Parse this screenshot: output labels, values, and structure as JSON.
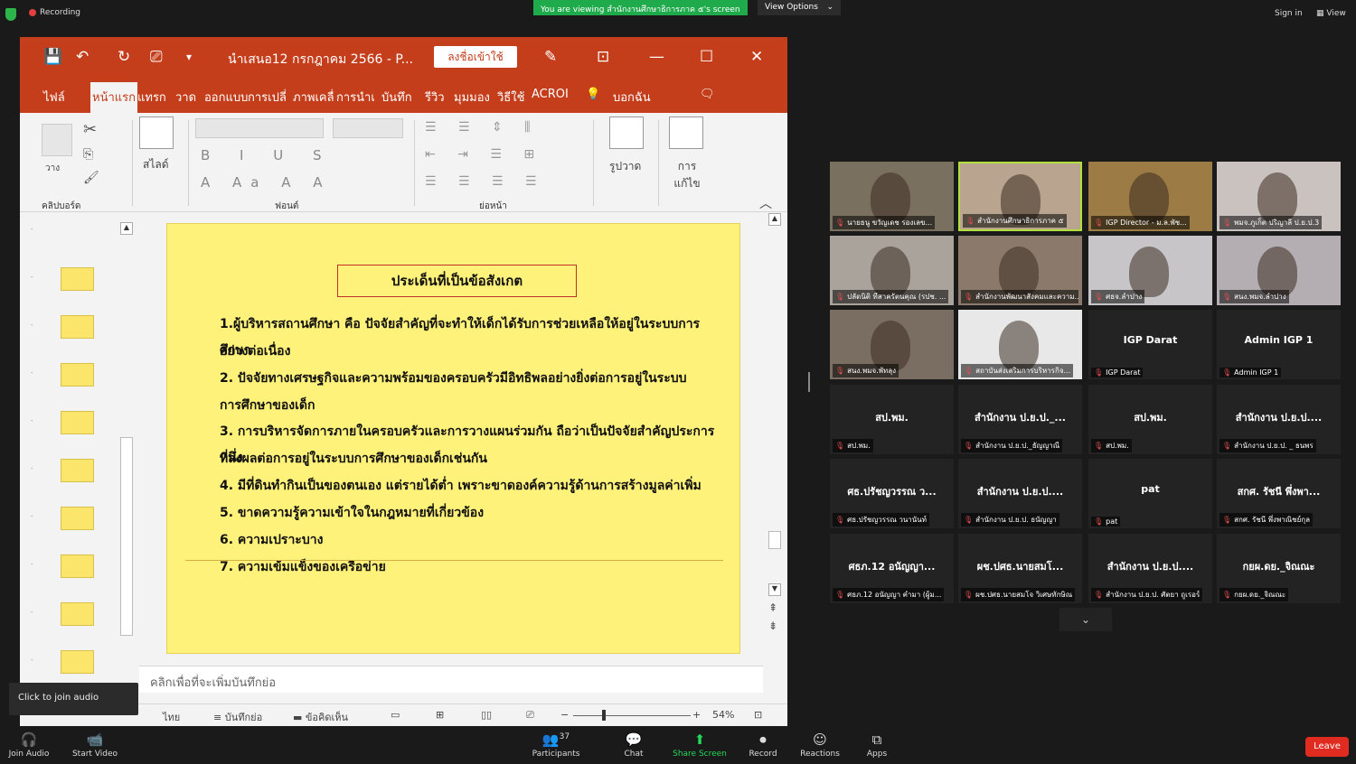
{
  "topbar": {
    "recording": "Recording",
    "viewing": "You are viewing สำนักงานศึกษาธิการภาค ๕'s screen",
    "view_options": "View Options",
    "sign_in": "Sign in",
    "view": "View"
  },
  "ppt": {
    "doc_title": "นำเสนอ12 กรกฎาคม 2566  -  P...",
    "signin_btn": "ลงชื่อเข้าใช้",
    "tabs": [
      "ไฟล์",
      "หน้าแรก",
      "แทรก",
      "วาด",
      "ออกแบบ",
      "การเปลี่",
      "ภาพเคลื่",
      "การนำเ",
      "บันทึก",
      "รีวิว",
      "มุมมอง",
      "วิธีใช้",
      "ACROI",
      "บอกฉัน"
    ],
    "ribbon": {
      "clipboard": "คลิปบอร์ด",
      "paste": "วาง",
      "slide": "สไลด์",
      "font": "ฟอนต์",
      "paragraph": "ย่อหน้า",
      "draw": "รูปวาด",
      "edit": "การแก้ไข"
    },
    "notes_placeholder": "คลิกเพื่อที่จะเพิ่มบันทึกย่อ",
    "status": {
      "lang": "ไทย",
      "notes": "บันทึกย่อ",
      "comments": "ข้อคิดเห็น",
      "zoom": "54%"
    }
  },
  "slide": {
    "title": "ประเด็นที่เป็นข้อสังเกต",
    "items": [
      "1.ผู้บริหารสถานศึกษา คือ ปัจจัยสำคัญที่จะทำให้เด็กได้รับการช่วยเหลือให้อยู่ในระบบการศึกษา",
      "อย่างต่อเนื่อง",
      "2. ปัจจัยทางเศรษฐกิจและความพร้อมของครอบครัวมีอิทธิพลอย่างยิ่งต่อการอยู่ในระบบ",
      "การศึกษาของเด็ก",
      "3. การบริหารจัดการภายในครอบครัวและการวางแผนร่วมกัน ถือว่าเป็นปัจจัยสำคัญประการหนึ่ง",
      "ที่ส่งผลต่อการอยู่ในระบบการศึกษาของเด็กเช่นกัน",
      "4. มีที่ดินทำกินเป็นของตนเอง แต่รายได้ต่ำ เพราะขาดองค์ความรู้ด้านการสร้างมูลค่าเพิ่ม",
      "5. ขาดความรู้ความเข้าใจในกฎหมายที่เกี่ยวข้อง",
      "6. ความเปราะบาง",
      "7. ความเข้มแข็งของเครือข่าย"
    ]
  },
  "tooltip": "Click to join audio",
  "gallery": [
    {
      "center": "",
      "label": "นายธนู ขวัญเดช รองเลข...",
      "video": "#7a7060"
    },
    {
      "center": "",
      "label": "สำนักงานศึกษาธิการภาค ๕",
      "video": "#b9a58f"
    },
    {
      "center": "",
      "label": "IGP Director - ม.ล.พัช...",
      "video": "#9c7b45"
    },
    {
      "center": "",
      "label": "พมจ.ภูเก็ต ปริญาลี ป.ย.ป.3",
      "video": "#c9c2be"
    },
    {
      "center": "",
      "label": "ปลัดนิติ ทีสาครัตนคุณ (รปช. ...",
      "video": "#a9a39c"
    },
    {
      "center": "",
      "label": "สำนักงานพัฒนาสังคมและความ...",
      "video": "#8b7a6c"
    },
    {
      "center": "",
      "label": "ศธจ.ลำปาง",
      "video": "#c7c5c8"
    },
    {
      "center": "",
      "label": "สนง.พมจ.ลำปาง",
      "video": "#b4aeb2"
    },
    {
      "center": "",
      "label": "สนง.พมจ.พัทลุง",
      "video": "#7a6e62"
    },
    {
      "center": "",
      "label": "สถาบันส่งเสริมการบริหารกิจ...",
      "video": "#e8e8e8"
    },
    {
      "center": "IGP Darat",
      "label": "IGP Darat",
      "video": ""
    },
    {
      "center": "Admin IGP 1",
      "label": "Admin IGP 1",
      "video": ""
    },
    {
      "center": "สป.พม.",
      "label": "สป.พม.",
      "video": ""
    },
    {
      "center": "สำนักงาน ป.ย.ป._...",
      "label": "สำนักงาน ป.ย.ป._ธัญญาณี",
      "video": ""
    },
    {
      "center": "สป.พม.",
      "label": "สป.พม.",
      "video": ""
    },
    {
      "center": "สำนักงาน ป.ย.ป....",
      "label": "สำนักงาน ป.ย.ป. _ ธนพร",
      "video": ""
    },
    {
      "center": "ศธ.ปรัชญวรรณ ว...",
      "label": "ศธ.ปรัชญวรรณ วนานันท์",
      "video": ""
    },
    {
      "center": "สำนักงาน ป.ย.ป....",
      "label": "สำนักงาน ป.ย.ป. ธนัญญา",
      "video": ""
    },
    {
      "center": "pat",
      "label": "pat",
      "video": ""
    },
    {
      "center": "สกศ. รัชนี พึ่งพา...",
      "label": "สกศ. รัชนี พึ่งพาณิชย์กุล",
      "video": ""
    },
    {
      "center": "ศธภ.12 อนัญญา...",
      "label": "ศธภ.12 อนัญญา คำมา (ผู้ม...",
      "video": ""
    },
    {
      "center": "ผช.ปศธ.นายสมโ...",
      "label": "ผช.ปศธ.นายสมโจ วิเศษทักษิณ",
      "video": ""
    },
    {
      "center": "สำนักงาน ป.ย.ป....",
      "label": "สำนักงาน ป.ย.ป. ศัตยา ถูเรอร์",
      "video": ""
    },
    {
      "center": "กยผ.ดย._จิณณะ",
      "label": "กยผ.ดย._จิณณะ",
      "video": ""
    }
  ],
  "toolbar": {
    "join_audio": "Join Audio",
    "start_video": "Start Video",
    "participants_count": "37",
    "participants": "Participants",
    "chat": "Chat",
    "share_screen": "Share Screen",
    "record": "Record",
    "reactions": "Reactions",
    "apps": "Apps",
    "leave": "Leave"
  }
}
